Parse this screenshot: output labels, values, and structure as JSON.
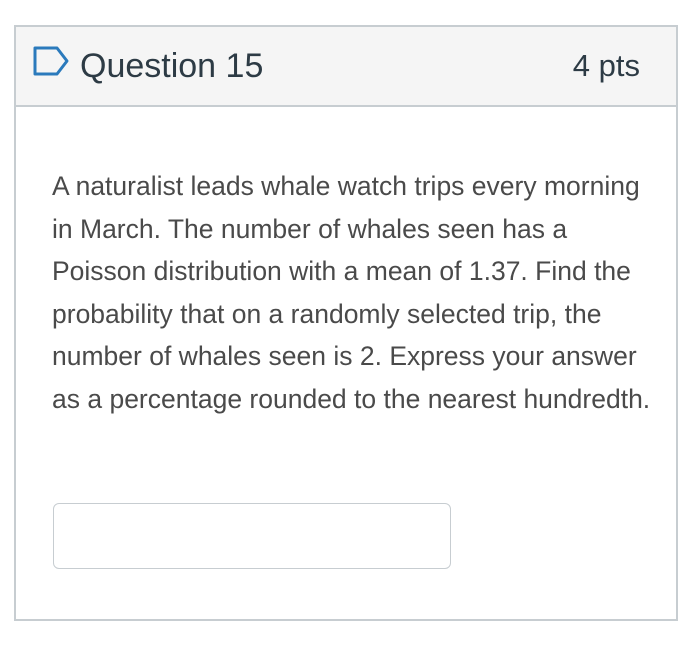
{
  "question": {
    "title": "Question 15",
    "points": "4 pts",
    "flag_icon": "bookmark-flag-outline",
    "flag_color": "#2b7abc",
    "text": "A naturalist leads whale watch trips every morning in March. The number of whales seen has a Poisson distribution with a mean of 1.37. Find the probability that on a randomly selected trip, the number of whales seen is 2. Express your answer as a percentage rounded to the nearest hundredth.",
    "answer_value": ""
  }
}
